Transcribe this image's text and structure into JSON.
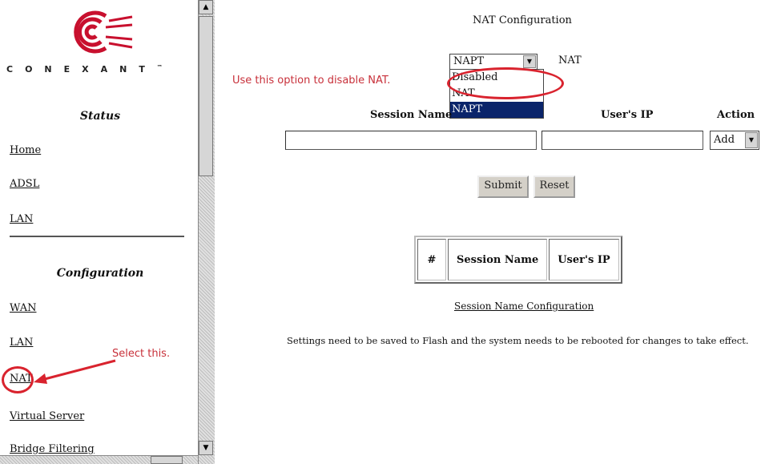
{
  "brand": {
    "name": "CONEXANT",
    "trademark": "™"
  },
  "sidebar": {
    "status_title": "Status",
    "status_items": [
      {
        "label": "Home"
      },
      {
        "label": "ADSL"
      },
      {
        "label": "LAN"
      }
    ],
    "config_title": "Configuration",
    "config_items": [
      {
        "label": "WAN"
      },
      {
        "label": "LAN"
      },
      {
        "label": "NAT"
      },
      {
        "label": "Virtual Server"
      },
      {
        "label": "Bridge Filtering"
      }
    ]
  },
  "annotations": {
    "disable_hint": "Use this option to disable NAT.",
    "select_hint": "Select this.",
    "color": "#d9232e"
  },
  "main": {
    "title": "NAT Configuration",
    "nat_mode": {
      "value": "NAPT",
      "label": "NAT",
      "options": [
        "Disabled",
        "NAT",
        "NAPT"
      ],
      "highlighted": "NAPT"
    },
    "columns": {
      "session_name": "Session Name",
      "users_ip": "User's IP",
      "action": "Action"
    },
    "action_select": {
      "value": "Add"
    },
    "buttons": {
      "submit": "Submit",
      "reset": "Reset"
    },
    "table": {
      "headers": [
        "#",
        "Session Name",
        "User's IP"
      ]
    },
    "session_link": "Session Name Configuration",
    "note": "Settings need to be saved to Flash and the system needs to be rebooted for changes to take effect."
  }
}
